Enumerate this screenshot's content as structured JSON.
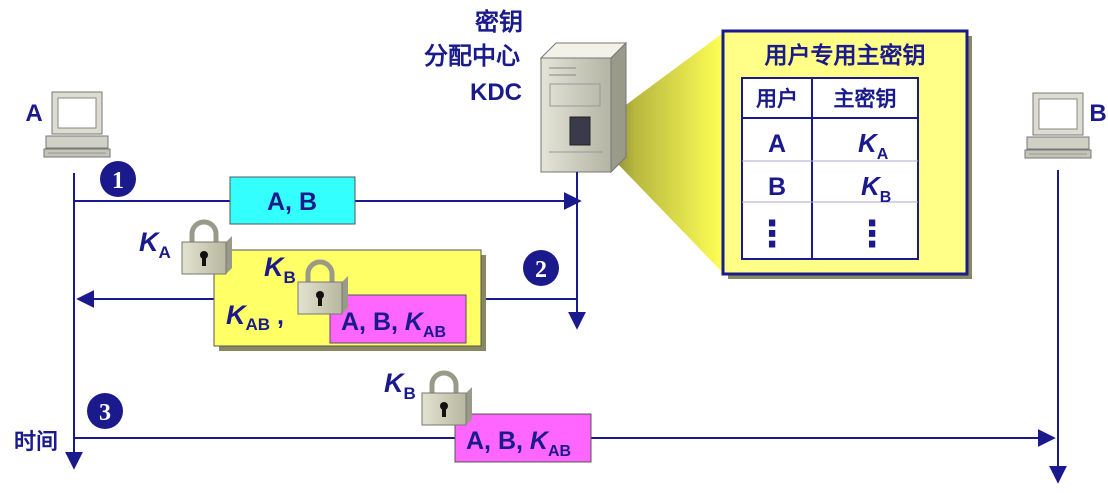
{
  "kdc": {
    "line1": "密钥",
    "line2": "分配中心",
    "line3": "KDC"
  },
  "hosts": {
    "a": "A",
    "b": "B"
  },
  "time_label": "时间",
  "steps": [
    "1",
    "2",
    "3"
  ],
  "step1": {
    "msg": "A, B"
  },
  "step2": {
    "outer_key": {
      "k": "K",
      "sub": "A"
    },
    "inner_key": {
      "k": "K",
      "sub": "B"
    },
    "session_key": {
      "k": "K",
      "sub": "AB",
      "suffix": " ,"
    },
    "inner_msg": {
      "prefix": "A, B, ",
      "k": "K",
      "sub": "AB"
    }
  },
  "step3": {
    "key": {
      "k": "K",
      "sub": "B"
    },
    "msg": {
      "prefix": "A, B, ",
      "k": "K",
      "sub": "AB"
    }
  },
  "key_table": {
    "title": "用户专用主密钥",
    "headers": [
      "用户",
      "主密钥"
    ],
    "rows": [
      {
        "user": "A",
        "k": "K",
        "sub": "A"
      },
      {
        "user": "B",
        "k": "K",
        "sub": "B"
      }
    ],
    "ellipsis": "⋮"
  },
  "colors": {
    "line": "#1a1a8c",
    "cyan_box": "#33ffff",
    "yellow_box": "#ffff66",
    "magenta_box": "#ff66ff",
    "table_bg": "#ffff88",
    "beam": "#ffff55"
  },
  "icons": [
    "computer-icon",
    "server-icon",
    "lock-icon",
    "step-number-badge"
  ]
}
